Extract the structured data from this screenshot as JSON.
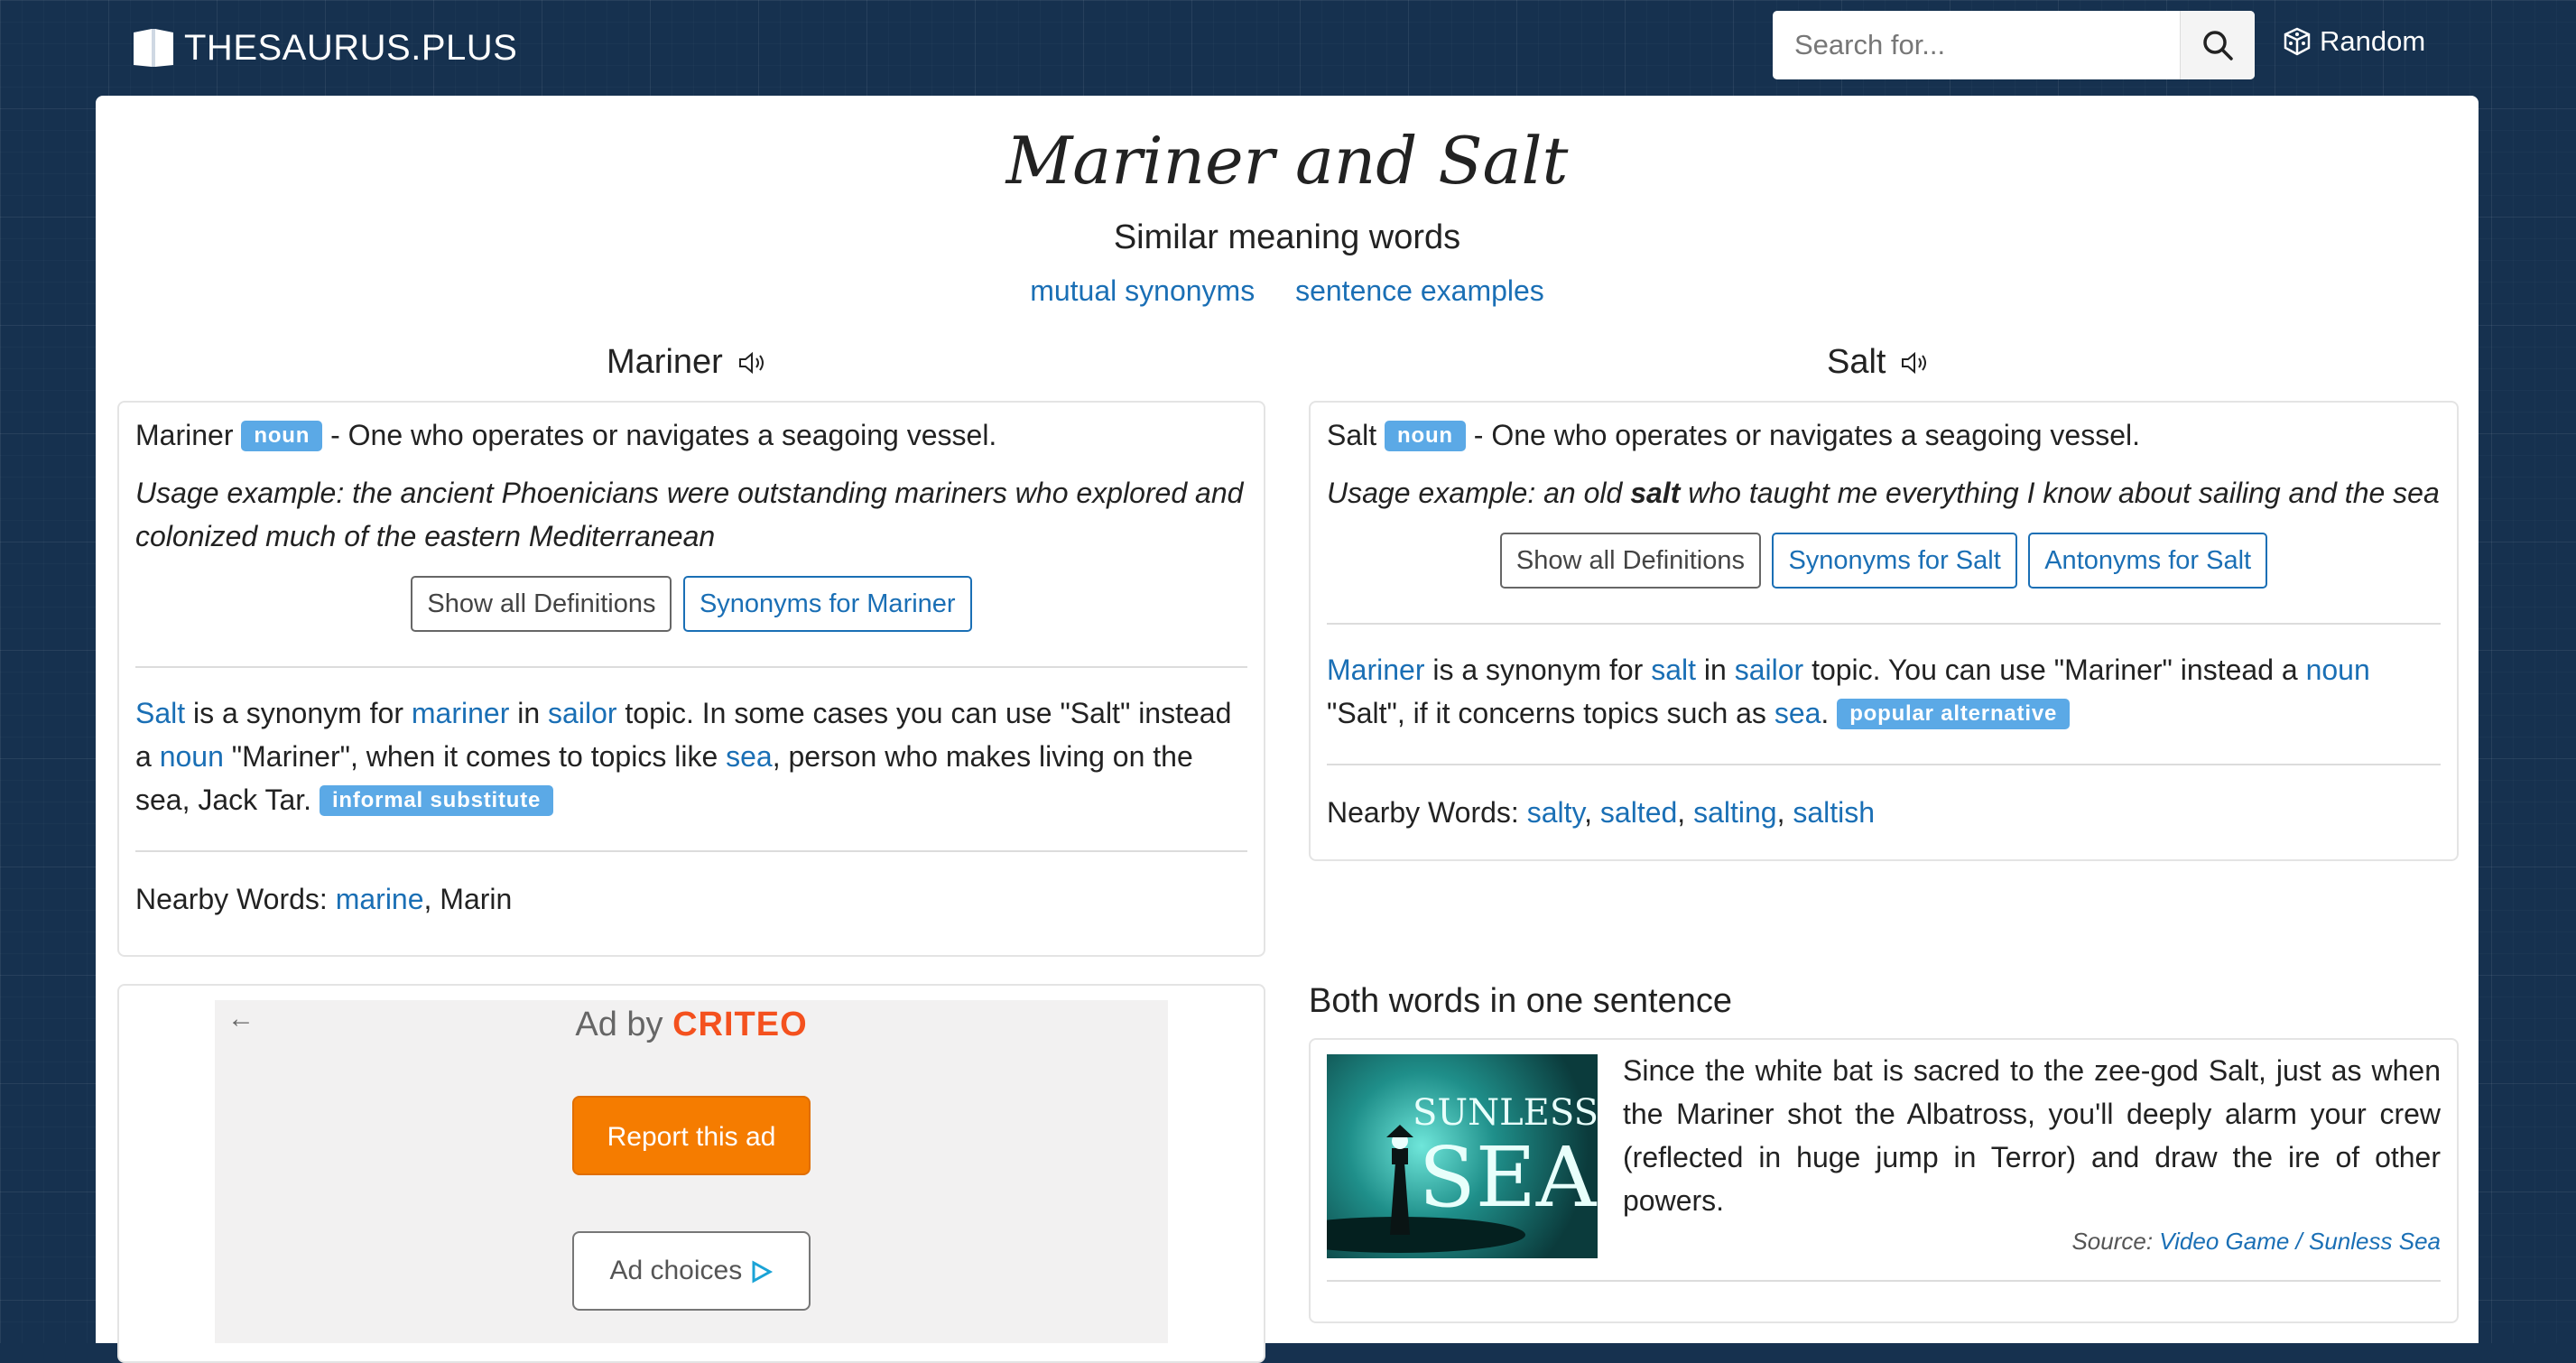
{
  "header": {
    "logo_text": "THESAURUS.PLUS",
    "search_placeholder": "Search for...",
    "random_label": "Random"
  },
  "page": {
    "title": "Mariner and Salt",
    "subtitle": "Similar meaning words",
    "links": [
      "mutual synonyms",
      "sentence examples"
    ]
  },
  "left": {
    "word": "Mariner",
    "definition": {
      "word": "Mariner",
      "pos": "noun",
      "text": "- One who operates or navigates a seagoing vessel."
    },
    "usage": "Usage example: the ancient Phoenicians were outstanding mariners who explored and colonized much of the eastern Mediterranean",
    "buttons": [
      "Show all Definitions",
      "Synonyms for Mariner"
    ],
    "synonym": {
      "w1": "Salt",
      "t1": " is a synonym for ",
      "w2": "mariner",
      "t2": " in ",
      "w3": "sailor",
      "t3": " topic. In some cases you can use \"Salt\" instead a ",
      "w4": "noun",
      "t4": " \"Mariner\", when it comes to topics like ",
      "w5": "sea",
      "t5": ", person who makes living on the sea, Jack Tar. ",
      "badge": "informal substitute"
    },
    "nearby_label": "Nearby Words: ",
    "nearby_link": "marine",
    "nearby_rest": ", Marin"
  },
  "right": {
    "word": "Salt",
    "definition": {
      "word": "Salt",
      "pos": "noun",
      "text": "- One who operates or navigates a seagoing vessel."
    },
    "usage_pre": "Usage example: an old ",
    "usage_bold": "salt",
    "usage_post": " who taught me everything I know about sailing and the sea",
    "buttons": [
      "Show all Definitions",
      "Synonyms for Salt",
      "Antonyms for Salt"
    ],
    "synonym": {
      "w1": "Mariner",
      "t1": " is a synonym for ",
      "w2": "salt",
      "t2": " in ",
      "w3": "sailor",
      "t3": " topic. You can use \"Mariner\" instead a ",
      "w4": "noun",
      "t4": " \"Salt\", if it concerns topics such as ",
      "w5": "sea",
      "t5": ". ",
      "badge": "popular alternative"
    },
    "nearby_label": "Nearby Words: ",
    "nearby": [
      "salty",
      "salted",
      "salting",
      "saltish"
    ],
    "sep": ", "
  },
  "both": {
    "heading": "Both words in one sentence",
    "image_text": [
      "SUNLESS",
      "SEA"
    ],
    "sentence": "Since the white bat is sacred to the zee-god Salt, just as when the Mariner shot the Albatross, you'll deeply alarm your crew (reflected in huge jump in Terror) and draw the ire of other powers.",
    "source_label": "Source: ",
    "source_link": "Video Game / Sunless Sea"
  },
  "ad": {
    "back": "←",
    "ad_by": "Ad by ",
    "brand": "CRITEO",
    "report": "Report this ad",
    "choices": "Ad choices"
  }
}
